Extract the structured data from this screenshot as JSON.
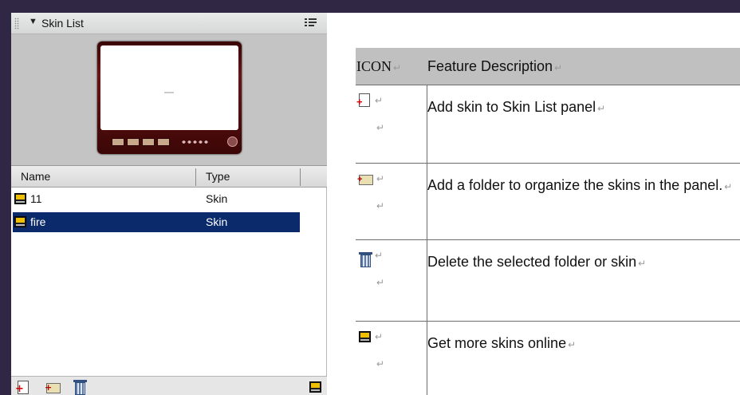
{
  "panel": {
    "title": "Skin List",
    "columns": {
      "name": "Name",
      "type": "Type"
    },
    "rows": [
      {
        "name": "11",
        "type": "Skin",
        "selected": false
      },
      {
        "name": "fire",
        "type": "Skin",
        "selected": true
      }
    ]
  },
  "table": {
    "header": {
      "icon_col": "ICON",
      "desc_col": "Feature Description",
      "mark": "↵"
    },
    "rows": [
      {
        "icon": "add-skin-icon",
        "description": "Add skin to Skin List panel",
        "mark": "↵"
      },
      {
        "icon": "add-folder-icon",
        "description": "Add a folder to organize the skins in the panel.",
        "mark": "↵"
      },
      {
        "icon": "delete-icon",
        "description": "Delete the selected folder or skin",
        "mark": "↵"
      },
      {
        "icon": "get-skins-icon",
        "description": "Get more skins online",
        "mark": "↵"
      }
    ]
  },
  "colors": {
    "background": "#2f2744",
    "selection": "#0b2a6b",
    "table_header": "#c0c0c0"
  }
}
